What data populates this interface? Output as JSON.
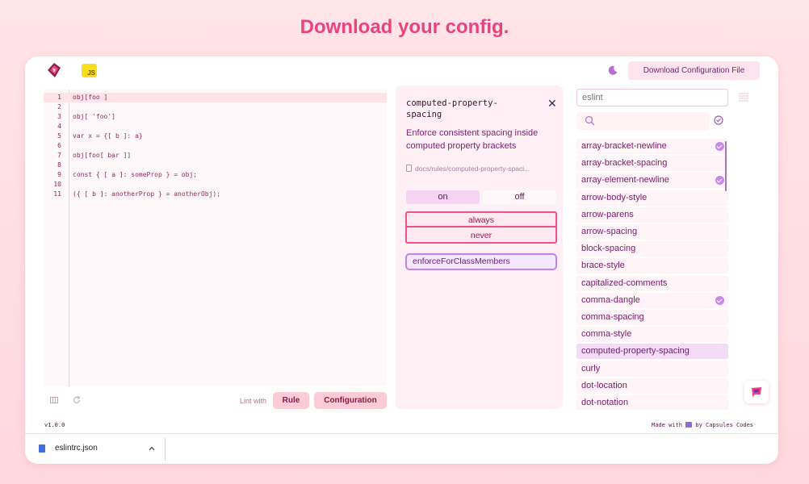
{
  "headline": "Download your config.",
  "header": {
    "download_button": "Download Configuration File",
    "js_badge": "JS"
  },
  "editor": {
    "lines": [
      {
        "n": "1",
        "code": "obj[foo ]"
      },
      {
        "n": "2",
        "code": ""
      },
      {
        "n": "3",
        "code": "obj[ 'foo']"
      },
      {
        "n": "4",
        "code": ""
      },
      {
        "n": "5",
        "code": "var x = {[ b ]: a}"
      },
      {
        "n": "6",
        "code": ""
      },
      {
        "n": "7",
        "code": "obj[foo[ bar ]]"
      },
      {
        "n": "8",
        "code": ""
      },
      {
        "n": "9",
        "code": "const { [ a ]: someProp } = obj;"
      },
      {
        "n": "10",
        "code": ""
      },
      {
        "n": "11",
        "code": "({ [ b ]: anotherProp } = anotherObj);"
      }
    ],
    "lint_label": "Lint with",
    "rule_button": "Rule",
    "config_button": "Configuration"
  },
  "rule_panel": {
    "name": "computed-property-spacing",
    "description": "Enforce consistent spacing inside computed property brackets",
    "doc_link": "docs/rules/computed-property-spaci...",
    "toggle_on": "on",
    "toggle_off": "off",
    "options": [
      "always",
      "never"
    ],
    "extra_option": "enforceForClassMembers"
  },
  "rules_list": {
    "filter_placeholder": "eslint",
    "search_placeholder": "",
    "items": [
      {
        "label": "array-bracket-newline",
        "checked": true
      },
      {
        "label": "array-bracket-spacing",
        "checked": false
      },
      {
        "label": "array-element-newline",
        "checked": true
      },
      {
        "label": "arrow-body-style",
        "checked": false
      },
      {
        "label": "arrow-parens",
        "checked": false
      },
      {
        "label": "arrow-spacing",
        "checked": false
      },
      {
        "label": "block-spacing",
        "checked": false
      },
      {
        "label": "brace-style",
        "checked": false
      },
      {
        "label": "capitalized-comments",
        "checked": false
      },
      {
        "label": "comma-dangle",
        "checked": true
      },
      {
        "label": "comma-spacing",
        "checked": false
      },
      {
        "label": "comma-style",
        "checked": false
      },
      {
        "label": "computed-property-spacing",
        "checked": false,
        "selected": true
      },
      {
        "label": "curly",
        "checked": false
      },
      {
        "label": "dot-location",
        "checked": false
      },
      {
        "label": "dot-notation",
        "checked": false
      }
    ]
  },
  "footer": {
    "version": "v1.0.0",
    "made_with_prefix": "Made with",
    "made_with_suffix": "by Capsules Codes"
  },
  "download_bar": {
    "file_name": "eslintrc.json"
  },
  "colors": {
    "accent": "#e8437f",
    "brand_purple": "#7a1b6a",
    "check": "#c68ae6"
  }
}
